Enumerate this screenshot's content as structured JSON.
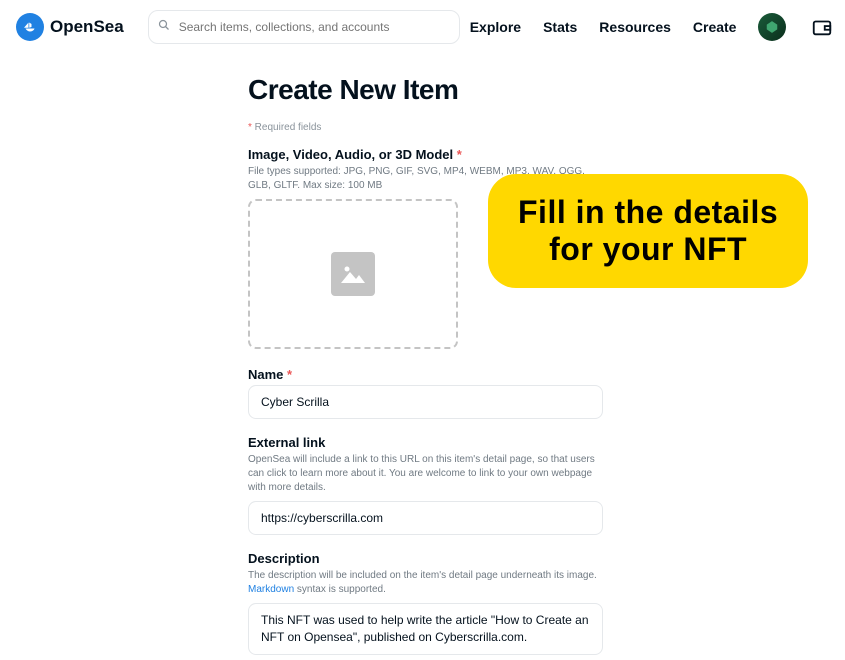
{
  "header": {
    "brand": "OpenSea",
    "search_placeholder": "Search items, collections, and accounts",
    "nav": {
      "explore": "Explore",
      "stats": "Stats",
      "resources": "Resources",
      "create": "Create"
    }
  },
  "page": {
    "title": "Create New Item",
    "required_note_ast": "*",
    "required_note": " Required fields",
    "media": {
      "label": "Image, Video, Audio, or 3D Model ",
      "ast": "*",
      "hint": "File types supported: JPG, PNG, GIF, SVG, MP4, WEBM, MP3, WAV, OGG, GLB, GLTF. Max size: 100 MB"
    },
    "name": {
      "label": "Name ",
      "ast": "*",
      "value": "Cyber Scrilla"
    },
    "external_link": {
      "label": "External link",
      "hint": "OpenSea will include a link to this URL on this item's detail page, so that users can click to learn more about it. You are welcome to link to your own webpage with more details.",
      "value": "https://cyberscrilla.com"
    },
    "description": {
      "label": "Description",
      "hint_prefix": "The description will be included on the item's detail page underneath its image. ",
      "hint_link": "Markdown",
      "hint_suffix": " syntax is supported.",
      "value": "This NFT was used to help write the article \"How to Create an NFT on Opensea\", published on Cyberscrilla.com."
    }
  },
  "annotation": {
    "line1": "Fill in the details",
    "line2": "for your NFT"
  }
}
